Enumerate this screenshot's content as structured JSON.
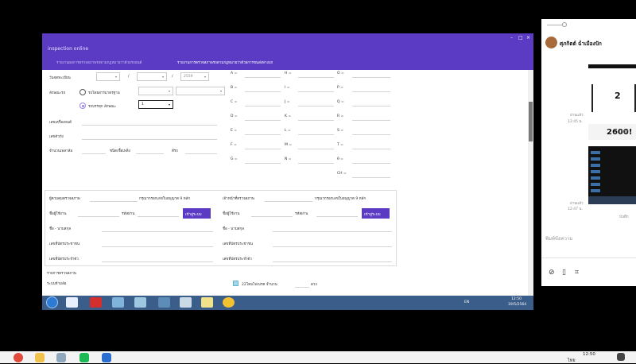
{
  "remote_window": {
    "title": "inspection online",
    "controls": [
      "–",
      "□",
      "×"
    ],
    "tabs": [
      "รายงานผลการตรวจสภาพรถตามกฎหมายว่าด้วยรถยนต์",
      "รายงานการตรวจสภาพรถตามกฎหมายว่าด้วยการขนส่งทางบก"
    ]
  },
  "form": {
    "reg_date_label": "วันจดทะเบียน",
    "date_sep1": "/",
    "date_sep2": "/",
    "year_value": "2559",
    "category_label": "ลักษณะรถ",
    "radio_standard": "รถโดยสารมาตรฐาน",
    "radio_truck": "รถบรรทุก ลักษณะ",
    "truck_type_value": "1",
    "engine_no_label": "เลขเครื่องยนต์",
    "chassis_no_label": "เลขตัวถัง",
    "wheels_label": "จำนวนเพลาล้อ",
    "fuel_label": "ชนิดเชื้อเพลิง",
    "color_label": "สีรถ",
    "measure_letters": [
      "A =",
      "B =",
      "C =",
      "D =",
      "E =",
      "F =",
      "G ="
    ],
    "measure_letters_2": [
      "H =",
      "I =",
      "J =",
      "K =",
      "L =",
      "M =",
      "N ="
    ],
    "measure_letters_3": [
      "O =",
      "P =",
      "Q =",
      "R =",
      "S =",
      "T =",
      "θ =",
      "CH ="
    ]
  },
  "inspectors": {
    "left": {
      "label": "ผู้ควบคุมตรวจสภาพ",
      "hint": "กรุณากรอกเลขใบอนุญาต 9 หลัก",
      "name_label": "ชื่อผู้ใช้งาน",
      "pass_label": "รหัสผ่าน",
      "login_button": "เข้าสู่ระบบ",
      "fullname_label": "ชื่อ - นามสกุล",
      "idcard_label": "เลขที่บัตรประชาชน",
      "license_label": "เลขที่บัตรประจำตัว"
    },
    "right": {
      "label": "เจ้าหน้าที่ตรวจสภาพ",
      "hint": "กรุณากรอกเลขใบอนุญาต 9 หลัก",
      "name_label": "ชื่อผู้ใช้งาน",
      "pass_label": "รหัสผ่าน",
      "login_button": "เข้าสู่ระบบ",
      "fullname_label": "ชื่อ - นามสกุล",
      "idcard_label": "เลขที่บัตรประชาชน",
      "license_label": "เลขที่บัตรประจำตัว"
    }
  },
  "bottom_section": {
    "result_label": "รายการตรวจสภาพ",
    "sub_label": "ระบบห้ามล้อ",
    "check_label": "22โคมไฟเบรค จำนวน",
    "unit_label": "ดวง"
  },
  "inner_taskbar": {
    "lang": "EN",
    "time": "12:50",
    "date": "19/5/2564"
  },
  "chat": {
    "contact_name": "ศุภกิตต์ ฉ่ำเมืองปัก",
    "image1_number": "2",
    "image1_caption": "2600!",
    "read_label_1": "อ่านแล้ว",
    "time_1": "12:45 น.",
    "saved_1": "บันทึก",
    "read_label_2": "อ่านแล้ว",
    "time_2": "12:47 น.",
    "saved_2": "บันทึก",
    "input_placeholder": "พิมพ์ข้อความ"
  },
  "taskbar": {
    "time": "12:50",
    "lang": "ไทย"
  },
  "colors": {
    "accent": "#5b3bc4",
    "taskbar": "#3a5d8a"
  }
}
